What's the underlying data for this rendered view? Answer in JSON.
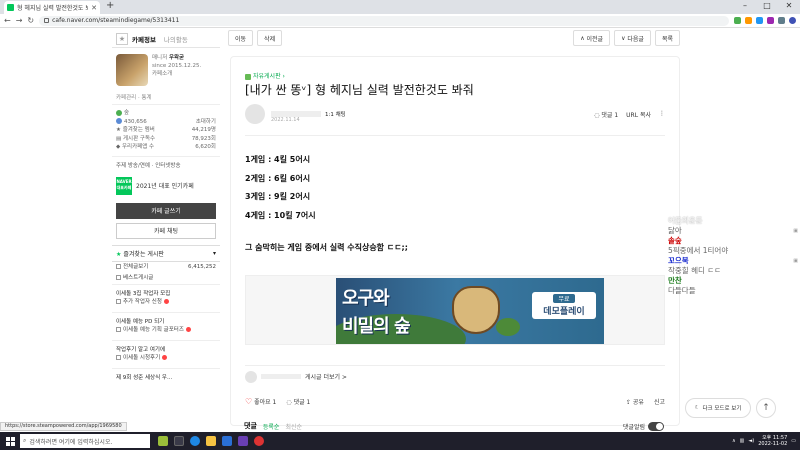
{
  "browser": {
    "tab_title": "형 헤지님 실력 발전한것도 봐줘",
    "url": "cafe.naver.com/steamindiegame/5313411",
    "status_url": "https://store.steampowered.com/app/1969580"
  },
  "sidebar": {
    "tabs": [
      "카페정보",
      "나의활동"
    ],
    "manager_label": "매니저",
    "manager_name": "우왁굳",
    "since": "since 2015.12.25.",
    "cafe_intro": "카페소개",
    "mini_links": "카페관리  ·  통계",
    "level_label": "숲",
    "member_count": "430,656",
    "invite": "초대하기",
    "stats": [
      {
        "label": "즐겨찾는 멤버",
        "value": "44,219명"
      },
      {
        "label": "게시판 구독수",
        "value": "78,923회"
      },
      {
        "label": "우리카페앱 수",
        "value": "6,620회"
      }
    ],
    "tags": "주제  방송/연예 · 인터넷방송",
    "ranking_badge": "NAVER 대표카페",
    "ranking_text": "2021년 대표 인기카페",
    "join_button": "카페 글쓰기",
    "chat_button": "카페 채팅",
    "fav_boards_title": "즐겨찾는 게시판",
    "boards": [
      {
        "name": "전체글보기",
        "count": "6,415,252"
      },
      {
        "name": "베스트게시글",
        "count": ""
      }
    ],
    "groups": [
      {
        "title": "이세돌 3집 작업자 모집",
        "item": "추가 작업자 신청"
      },
      {
        "title": "이세돌 예능 PD 되기",
        "item": "이세돌 예능 기획 글포터즈"
      },
      {
        "title": "작업후기 알고 여기에",
        "item": "이세돌 시청후기"
      },
      {
        "title": "제 9회 성준 세상식 우...",
        "item": ""
      }
    ]
  },
  "topbar": {
    "move": "이동",
    "delete": "삭제",
    "prev": "이전글",
    "next": "다음글",
    "list": "목록"
  },
  "article": {
    "board": "자유게시판",
    "title": "[내가 싼 똥ᵛ] 형 헤지님 실력 발전한것도 봐줘",
    "grade": "1:1 채팅",
    "date": "2022.11.14",
    "comments_label": "댓글 1",
    "url_copy": "URL 복사",
    "lines": [
      "1게임 : 4킬 5어시",
      "2게임 : 6킬 6어시",
      "3게임 : 9킬 2어시",
      "4게임 : 10킬 7어시"
    ],
    "closing": "그 숨막히는 게임 중에서 실력 수직상승함 ㄷㄷ;;",
    "banner_line1": "오구와",
    "banner_line2": "비밀의 숲",
    "banner_free": "무료",
    "banner_demo": "데모플레이",
    "more_posts": "게시글 더보기 >",
    "likes": "좋아요 1",
    "comments": "댓글 1",
    "share": "공유",
    "report": "신고"
  },
  "comment_bar": {
    "label": "댓글",
    "sort1": "등록순",
    "sort2": "최신순",
    "toggle_label": "댓글알림"
  },
  "floating": {
    "dark_mode": "다크 모드로 보기",
    "top": "↑"
  },
  "chat": [
    {
      "name": "어둠의운둔",
      "msg": "",
      "color": "#f5f5f5"
    },
    {
      "name": "",
      "msg": "닳아",
      "color": "#666"
    },
    {
      "name": "솔숲",
      "msg": "",
      "color": "#c00"
    },
    {
      "name": "",
      "msg": "5픽중에서 1티어야",
      "color": "#666"
    },
    {
      "name": "꼬으북",
      "msg": "",
      "color": "#1a2ccf"
    },
    {
      "name": "",
      "msg": "작중힐 헤디 ㄷㄷ",
      "color": "#666"
    },
    {
      "name": "만찬",
      "msg": "",
      "color": "#1a7a1a"
    },
    {
      "name": "",
      "msg": "다들다들",
      "color": "#666"
    }
  ],
  "taskbar": {
    "search_placeholder": "검색하려면 여기에 입력하십시오.",
    "time": "오후 11:57",
    "date": "2022-11-02"
  },
  "colors": {
    "accent": "#03c75a",
    "taskbar": "#1f1f2b"
  }
}
